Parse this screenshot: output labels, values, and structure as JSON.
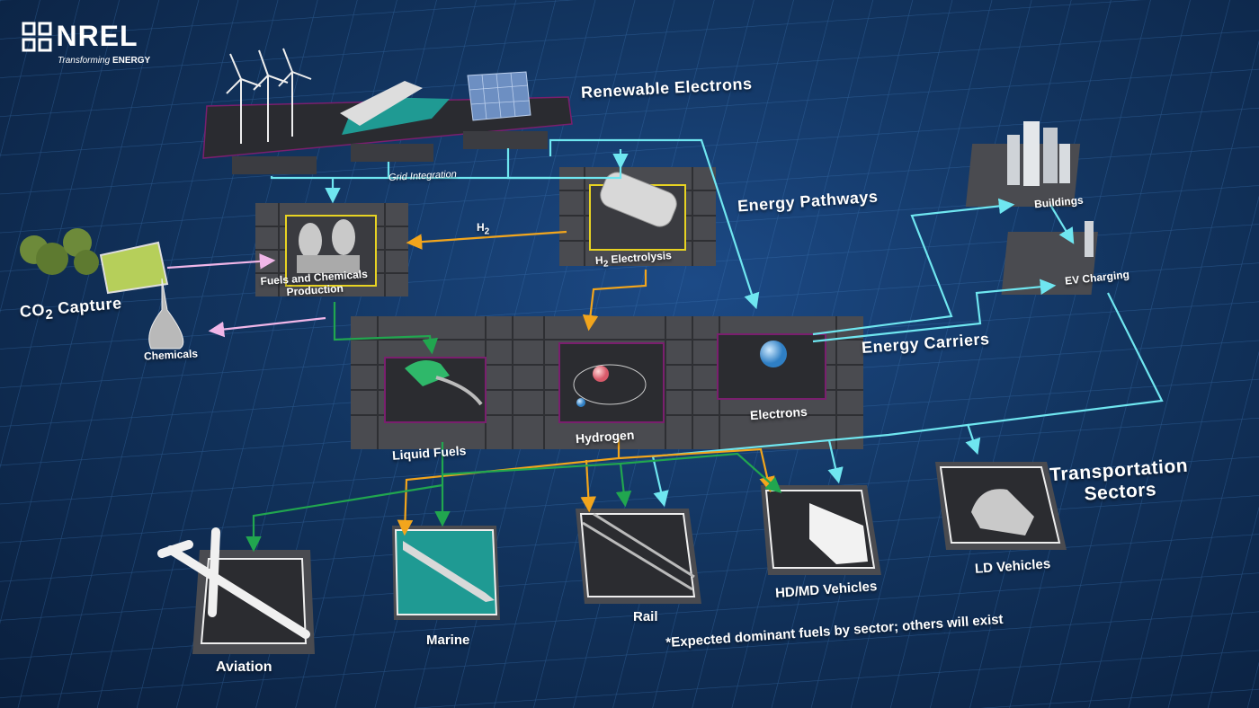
{
  "logo": {
    "name": "NREL",
    "tagline_prefix": "Transforming",
    "tagline_suffix": "ENERGY"
  },
  "sections": {
    "renewable": "Renewable Electrons",
    "pathways": "Energy Pathways",
    "carriers": "Energy Carriers",
    "transport_line1": "Transportation",
    "transport_line2": "Sectors"
  },
  "nodes": {
    "grid_integration": "Grid Integration",
    "h2_label": "H",
    "h2_sub": "2",
    "electrolysis_prefix": "H",
    "electrolysis_sub": "2",
    "electrolysis_suffix": " Electrolysis",
    "fuels_line1": "Fuels and Chemicals",
    "fuels_line2": "Production",
    "co2_prefix": "CO",
    "co2_sub": "2",
    "co2_suffix": " Capture",
    "chemicals": "Chemicals",
    "buildings": "Buildings",
    "ev_charging": "EV Charging",
    "liquid_fuels": "Liquid Fuels",
    "hydrogen": "Hydrogen",
    "electrons": "Electrons"
  },
  "sectors": {
    "aviation": "Aviation",
    "marine": "Marine",
    "rail": "Rail",
    "hdmd": "HD/MD Vehicles",
    "ld": "LD Vehicles"
  },
  "footnote": "*Expected dominant fuels by sector; others will exist",
  "colors": {
    "electron_flow": "#6fe6f0",
    "hydrogen_flow": "#f2a51c",
    "liquid_flow": "#21a64f",
    "co2_flow": "#f0b6e8",
    "carrier_border": "#7a1f6e",
    "h2_border": "#e8d322"
  }
}
